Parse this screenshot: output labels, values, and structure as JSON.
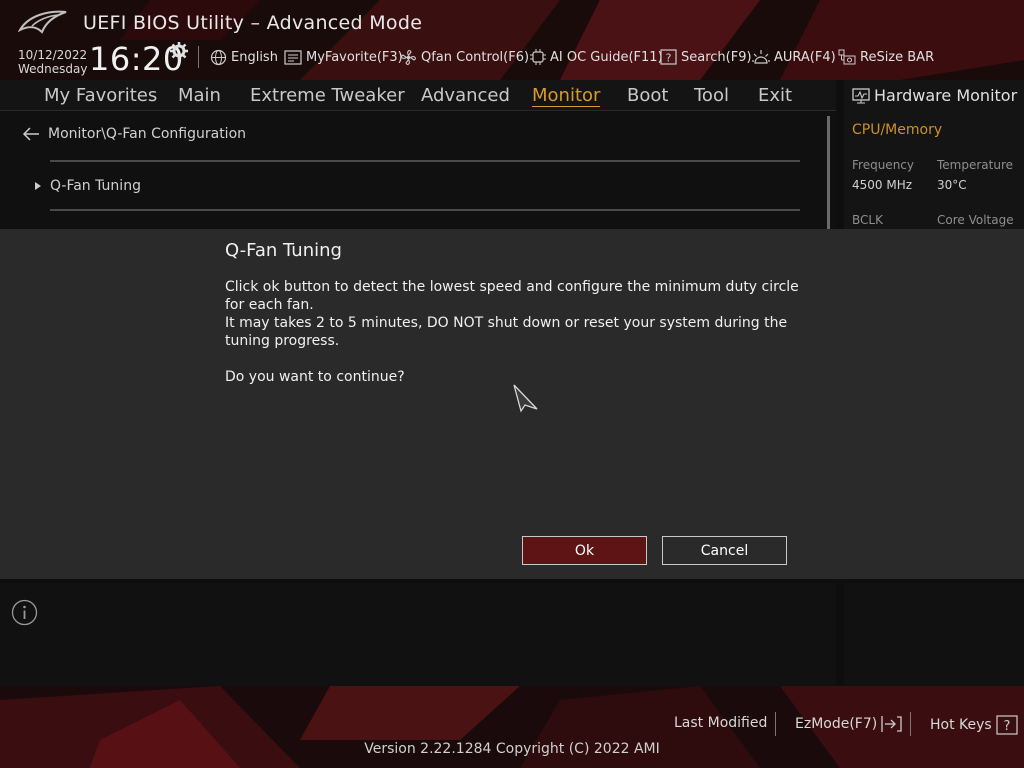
{
  "app": {
    "title": "UEFI BIOS Utility – Advanced Mode",
    "date": "10/12/2022",
    "weekday": "Wednesday",
    "time": "16:20"
  },
  "toolbar": [
    {
      "label": "English",
      "icon": "globe-icon"
    },
    {
      "label": "MyFavorite(F3)",
      "icon": "favorite-icon"
    },
    {
      "label": "Qfan Control(F6)",
      "icon": "fan-icon"
    },
    {
      "label": "AI OC Guide(F11)",
      "icon": "chip-icon"
    },
    {
      "label": "Search(F9)",
      "icon": "search-help-icon"
    },
    {
      "label": "AURA(F4)",
      "icon": "aura-icon"
    },
    {
      "label": "ReSize BAR",
      "icon": "resize-bar-icon"
    }
  ],
  "nav": {
    "tabs": [
      "My Favorites",
      "Main",
      "Extreme Tweaker",
      "Advanced",
      "Monitor",
      "Boot",
      "Tool",
      "Exit"
    ],
    "active": "Monitor"
  },
  "main": {
    "breadcrumb": "Monitor\\Q-Fan Configuration",
    "items": [
      "Q-Fan Tuning"
    ]
  },
  "hardware_monitor": {
    "title": "Hardware Monitor",
    "section": "CPU/Memory",
    "frequency_label": "Frequency",
    "frequency_value": "4500 MHz",
    "temperature_label": "Temperature",
    "temperature_value": "30°C",
    "bclk_label": "BCLK",
    "core_voltage_label": "Core Voltage"
  },
  "dialog": {
    "title": "Q-Fan Tuning",
    "line1": "Click ok button to detect the lowest speed and configure the minimum duty circle for each fan.",
    "line2": "It may takes 2 to 5 minutes, DO NOT shut down or reset your system during the tuning progress.",
    "line3": "Do you want to continue?",
    "ok_label": "Ok",
    "cancel_label": "Cancel"
  },
  "footer": {
    "last_modified": "Last Modified",
    "ezmode": "EzMode(F7)",
    "hot_keys": "Hot Keys",
    "version": "Version 2.22.1284 Copyright (C) 2022 AMI"
  },
  "colors": {
    "accent": "#d99a2b",
    "ok_button": "#5e1414",
    "dialog_bg": "#2a2a2a",
    "brand_red": "#8b1212"
  }
}
